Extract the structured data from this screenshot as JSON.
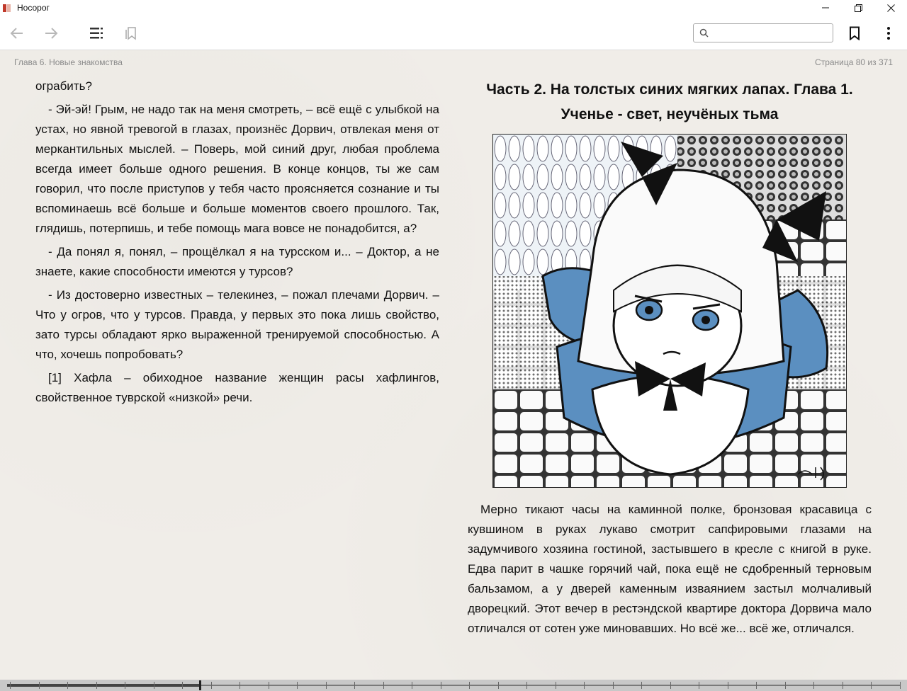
{
  "window": {
    "title": "Носорог",
    "minimize_icon": "minimize-icon",
    "maximize_icon": "restore-icon",
    "close_icon": "close-icon"
  },
  "toolbar": {
    "back_icon": "arrow-left-icon",
    "forward_icon": "arrow-right-icon",
    "toc_icon": "list-icon",
    "bookmarks_list_icon": "bookmark-outline-icon",
    "search_placeholder": "",
    "search_value": "",
    "bookmark_icon": "bookmark-icon",
    "menu_icon": "more-vertical-icon"
  },
  "header": {
    "chapter": "Глава 6. Новые знакомства",
    "page_indicator": "Страница 80 из 371"
  },
  "left_page": {
    "paragraphs": [
      "ограбить?",
      "- Эй-эй! Грым, не надо так на меня смотреть, – всё ещё с улыбкой на устах, но явной тревогой в глазах, произнёс Дорвич, отвлекая меня от меркантильных мыслей. – Поверь, мой синий друг, любая проблема всегда имеет больше одного решения. В конце концов, ты же сам говорил, что после приступов у тебя часто проясняется сознание и ты вспоминаешь всё больше и больше моментов своего прошлого. Так, глядишь, потерпишь, и тебе помощь мага вовсе не понадобится, а?",
      "- Да понял я, понял, – прощёлкал я на турсском и... – Доктор, а не знаете, какие способности имеются у турсов?",
      "- Из достоверно известных – телекинез, – пожал плечами Дорвич. – Что у огров, что у турсов. Правда, у первых это пока лишь свойство, зато турсы обладают ярко выраженной тренируемой способностью. А что, хочешь попробовать?",
      "[1] Хафла – обиходное название женщин расы хафлингов, свойственное туврской «низкой» речи."
    ]
  },
  "right_page": {
    "heading": "Часть 2. На толстых синих мягких лапах. Глава 1. Ученье - свет, неучёных тьма",
    "paragraph": "Мерно тикают часы на каминной полке, бронзовая красавица с кувшином в руках лукаво смотрит сапфировыми глазами на задумчивого хозяина гостиной, застывшего в кресле с книгой в руке. Едва парит в чашке горячий чай, пока ещё не сдобренный терновым бальзамом, а у дверей каменным изваянием застыл молчаливый дворецкий. Этот вечер в рестэндской квартире доктора Дорвича мало отличался от сотен уже миновавших. Но всё же... всё же, отличался."
  },
  "progress": {
    "current_page": 80,
    "total_pages": 371,
    "fraction": 0.2156
  },
  "colors": {
    "page_bg": "#f0ede8",
    "illustration_blue": "#5b8fc0"
  }
}
